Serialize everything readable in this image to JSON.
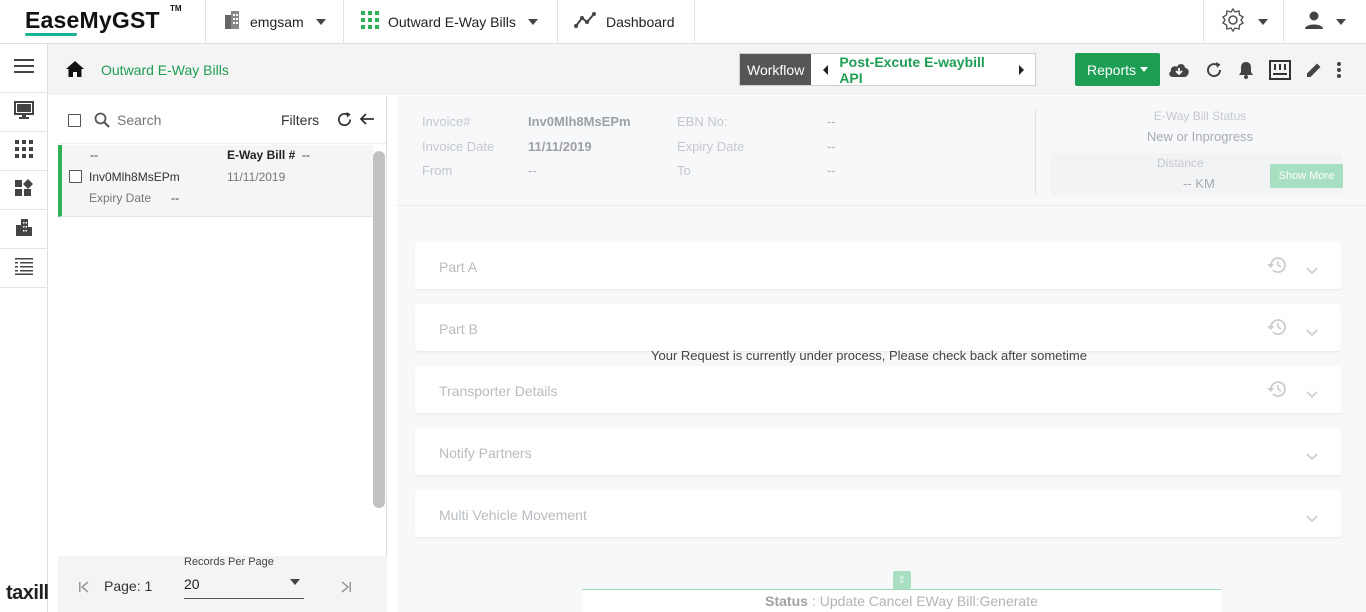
{
  "app": {
    "logo_text": "EaseMyGST",
    "logo_tm": "TM",
    "footer_brand": "taxill"
  },
  "topnav": {
    "org_label": "emgsam",
    "module_label": "Outward E-Way Bills",
    "dashboard_label": "Dashboard"
  },
  "breadcrumb": {
    "current": "Outward E-Way Bills"
  },
  "workflow": {
    "label": "Workflow",
    "current_step": "Post-Excute E-waybill API"
  },
  "toolbar": {
    "reports_label": "Reports"
  },
  "list": {
    "search_placeholder": "Search",
    "filters_label": "Filters",
    "rows": [
      {
        "top_left": "--",
        "ewb_label": "E-Way Bill #",
        "ewb_value": "--",
        "invoice": "Inv0Mlh8MsEPm",
        "date": "11/11/2019",
        "expiry_label": "Expiry Date",
        "expiry_value": "--"
      }
    ],
    "footer": {
      "page_label": "Page: 1",
      "records_per_page_label": "Records Per Page",
      "records_per_page_value": "20"
    }
  },
  "summary": {
    "invoice_label": "Invoice#",
    "invoice_value": "Inv0Mlh8MsEPm",
    "invoice_date_label": "Invoice Date",
    "invoice_date_value": "11/11/2019",
    "from_label": "From",
    "from_value": "--",
    "ebn_label": "EBN No:",
    "ebn_value": "--",
    "expiry_label": "Expiry Date",
    "expiry_value": "--",
    "to_label": "To",
    "to_value": "--",
    "status_label": "E-Way Bill Status",
    "status_value": "New or Inprogress",
    "distance_label": "Distance",
    "distance_value": "-- KM",
    "show_more_label": "Show More"
  },
  "sections": [
    {
      "label": "Part A"
    },
    {
      "label": "Part B"
    },
    {
      "label": "Transporter Details"
    },
    {
      "label": "Notify Partners"
    },
    {
      "label": "Multi Vehicle Movement"
    }
  ],
  "process_message": "Your Request is currently under process, Please check back after sometime",
  "status_bar": {
    "label": "Status",
    "value": ": Update Cancel EWay Bill:Generate"
  },
  "colors": {
    "brand_green": "#1e9e54",
    "accent_teal": "#19b394",
    "row_highlight": "#2fb155"
  }
}
